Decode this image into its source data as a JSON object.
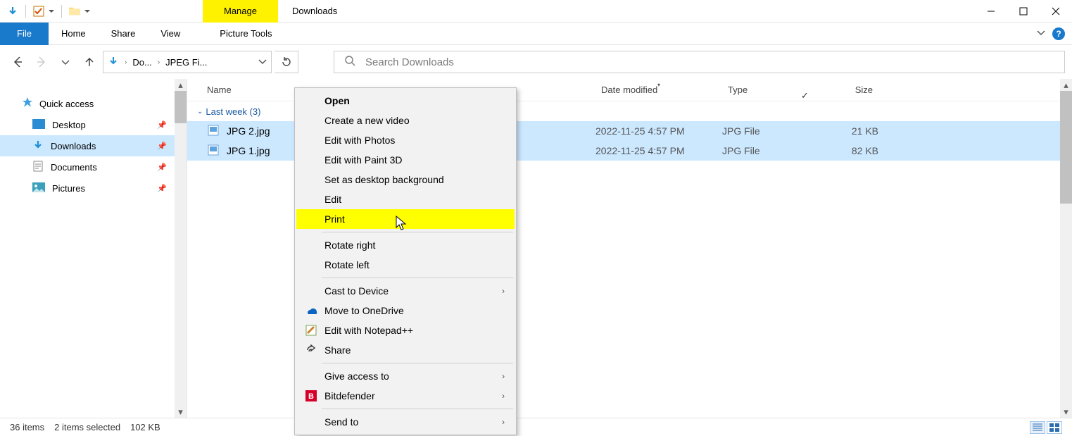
{
  "window": {
    "title": "Downloads",
    "manage_label": "Manage"
  },
  "ribbon": {
    "file": "File",
    "home": "Home",
    "share": "Share",
    "view": "View",
    "picture_tools": "Picture Tools"
  },
  "address": {
    "seg1": "Do...",
    "seg2": "JPEG Fi..."
  },
  "search": {
    "placeholder": "Search Downloads"
  },
  "nav": {
    "quick_access": "Quick access",
    "desktop": "Desktop",
    "downloads": "Downloads",
    "documents": "Documents",
    "pictures": "Pictures"
  },
  "columns": {
    "name": "Name",
    "date": "Date modified",
    "type": "Type",
    "size": "Size"
  },
  "group": {
    "label": "Last week (3)"
  },
  "files": [
    {
      "name": "JPG 2.jpg",
      "date": "2022-11-25 4:57 PM",
      "type": "JPG File",
      "size": "21 KB"
    },
    {
      "name": "JPG 1.jpg",
      "date": "2022-11-25 4:57 PM",
      "type": "JPG File",
      "size": "82 KB"
    }
  ],
  "status": {
    "total": "36 items",
    "selected": "2 items selected",
    "size": "102 KB"
  },
  "context_menu": {
    "open": "Open",
    "new_video": "Create a new video",
    "edit_photos": "Edit with Photos",
    "edit_paint3d": "Edit with Paint 3D",
    "set_bg": "Set as desktop background",
    "edit": "Edit",
    "print": "Print",
    "rotate_right": "Rotate right",
    "rotate_left": "Rotate left",
    "cast": "Cast to Device",
    "onedrive": "Move to OneDrive",
    "notepadpp": "Edit with Notepad++",
    "share": "Share",
    "give_access": "Give access to",
    "bitdefender": "Bitdefender",
    "send_to": "Send to"
  }
}
